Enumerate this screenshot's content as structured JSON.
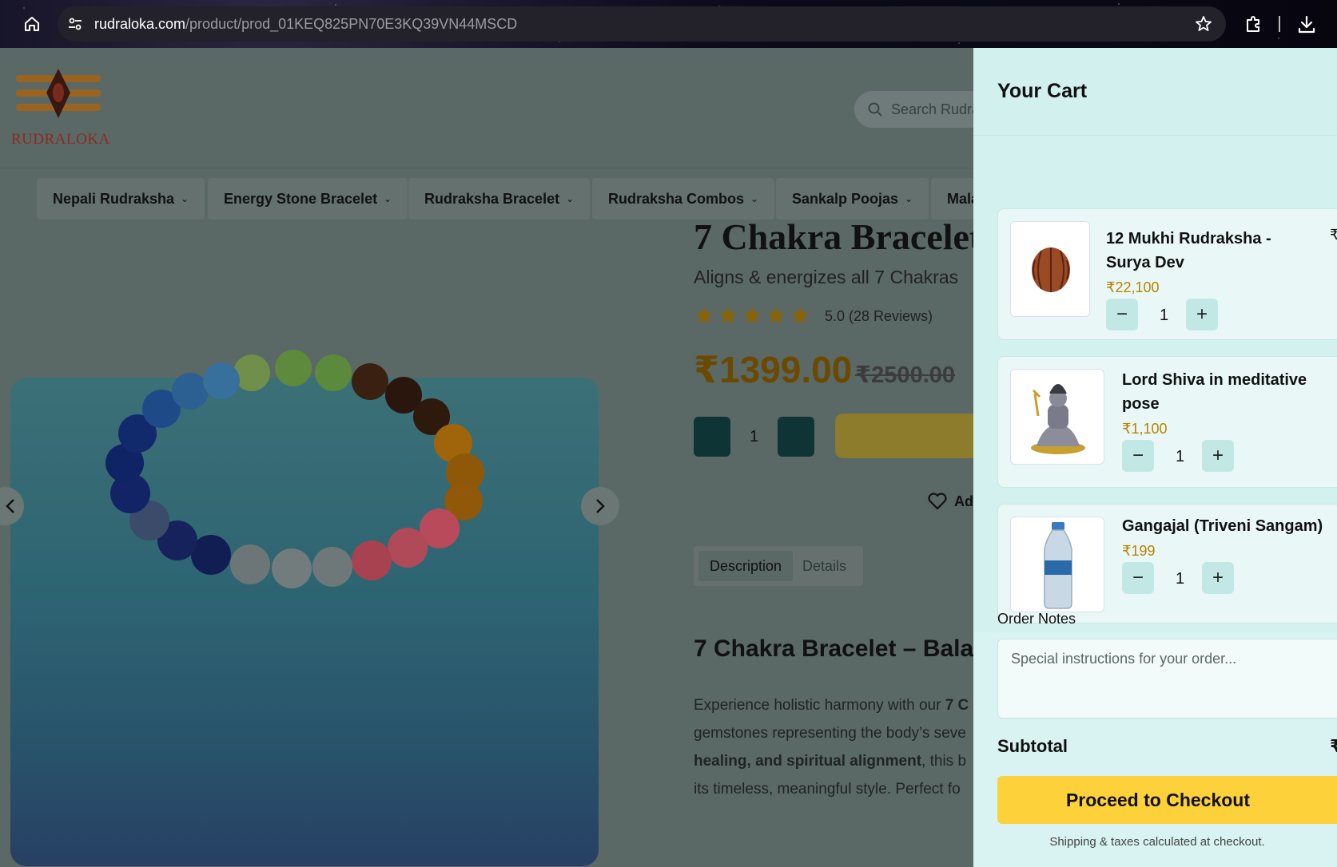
{
  "browser": {
    "url_host": "rudraloka.com",
    "url_path": "/product/prod_01KEQ825PN70E3KQ39VN44MSCD"
  },
  "site": {
    "logo_text": "RUDRALOKA",
    "search_placeholder": "Search Rudra"
  },
  "nav": {
    "items": [
      {
        "label": "Nepali Rudraksha"
      },
      {
        "label": "Energy Stone Bracelet"
      },
      {
        "label": "Rudraksha Bracelet"
      },
      {
        "label": "Rudraksha Combos"
      },
      {
        "label": "Sankalp Poojas"
      },
      {
        "label": "Mala"
      }
    ]
  },
  "product": {
    "title": "7 Chakra Bracelet",
    "subtitle": "Aligns & energizes all 7 Chakras",
    "rating_text": "5.0 (28 Reviews)",
    "rating": 5,
    "price": "₹1399.00",
    "old_price": "₹2500.00",
    "quantity": "1",
    "wishlist_label": "Ad",
    "tabs": [
      {
        "label": "Description"
      },
      {
        "label": "Details"
      }
    ],
    "desc_heading": "7 Chakra Bracelet – Bala",
    "desc_lines": [
      {
        "normal": "Experience holistic harmony with our ",
        "bold": "7 C"
      },
      {
        "normal": "gemstones representing the body’s seve",
        "bold": ""
      },
      {
        "bold": "healing, and spiritual alignment",
        "normal": ", this b"
      },
      {
        "normal": "its timeless, meaningful style. Perfect fo",
        "bold": ""
      }
    ]
  },
  "cart": {
    "title": "Your Cart",
    "items": [
      {
        "name": "12 Mukhi Rudraksha - Surya Dev",
        "price": "₹22,100",
        "qty": "1",
        "total": "₹"
      },
      {
        "name": "Lord Shiva in meditative pose",
        "price": "₹1,100",
        "qty": "1",
        "total": ""
      },
      {
        "name": "Gangajal (Triveni Sangam)",
        "price": "₹199",
        "qty": "1",
        "total": ""
      }
    ],
    "notes_label": "Order Notes",
    "notes_placeholder": "Special instructions for your order...",
    "subtotal_label": "Subtotal",
    "subtotal_value": "₹",
    "checkout_label": "Proceed to Checkout",
    "shipping_note": "Shipping & taxes calculated at checkout."
  },
  "colors": {
    "accent": "#fdd13a",
    "price_text": "#b88300",
    "cart_bg": "#d8f3f1"
  }
}
